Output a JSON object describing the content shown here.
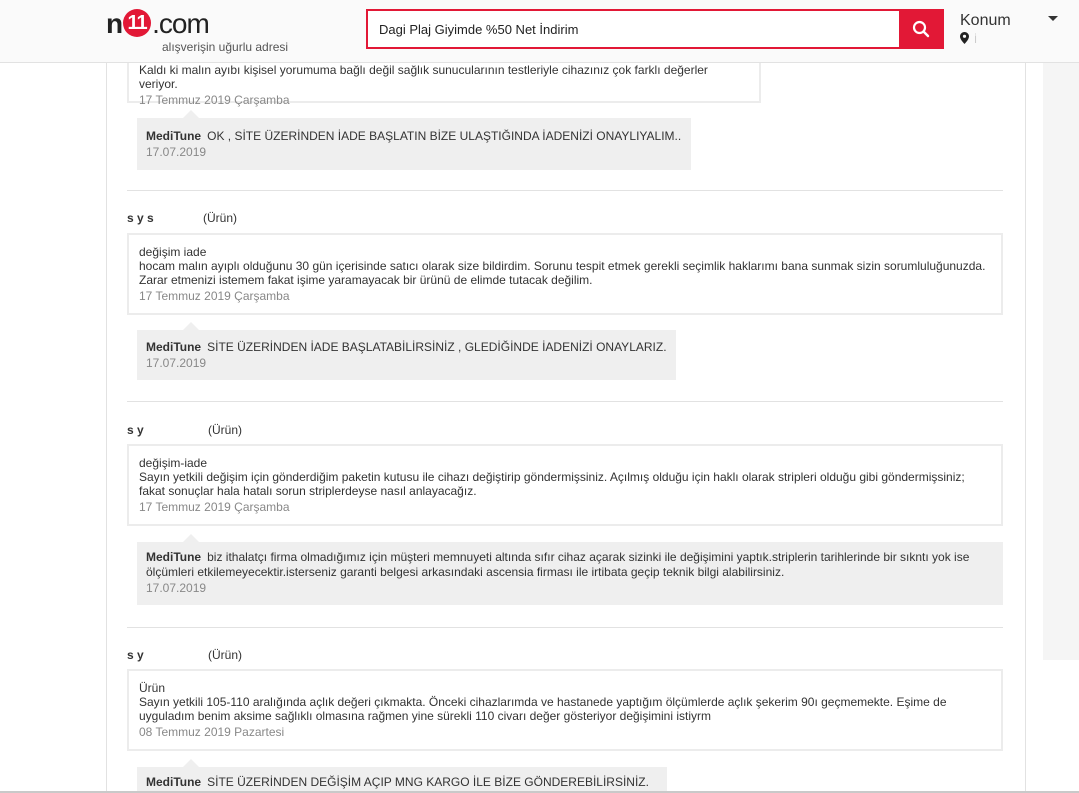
{
  "header": {
    "logo_n": "n",
    "logo_bug": "11",
    "logo_com": ".com",
    "logo_tagline": "alışverişin uğurlu adresi",
    "search_value": "Dagi Plaj Giyimde %50 Net İndirim",
    "konum_label": "Konum",
    "konum_value": "İ"
  },
  "thread1": {
    "question_text": "Kaldı ki malın ayıbı kişisel yorumuma bağlı değil sağlık sunucularının testleriyle cihazınız çok farklı değerler veriyor.",
    "question_date": "17 Temmuz 2019 Çarşamba",
    "answer_seller": "MediTune",
    "answer_text": "OK , SİTE ÜZERİNDEN İADE BAŞLATIN BİZE ULAŞTIĞINDA İADENİZİ ONAYLIYALIM..",
    "answer_date": "17.07.2019"
  },
  "thread2": {
    "user": "s y s",
    "tag": "(Ürün)",
    "question_title": "değişim iade",
    "question_text": "hocam malın ayıplı olduğunu 30 gün içerisinde satıcı olarak size bildirdim. Sorunu tespit etmek gerekli seçimlik haklarımı bana sunmak sizin sorumluluğunuzda. Zarar etmenizi istemem fakat işime yaramayacak bir ürünü de elimde tutacak değilim.",
    "question_date": "17 Temmuz 2019 Çarşamba",
    "answer_seller": "MediTune",
    "answer_text": "SİTE ÜZERİNDEN İADE BAŞLATABİLİRSİNİZ , GLEDİĞİNDE İADENİZİ ONAYLARIZ.",
    "answer_date": "17.07.2019"
  },
  "thread3": {
    "user": "s y",
    "tag": "(Ürün)",
    "question_title": "değişim-iade",
    "question_text": "Sayın yetkili değişim için gönderdiğim paketin kutusu ile cihazı değiştirip göndermişsiniz. Açılmış olduğu için haklı olarak stripleri olduğu gibi göndermişsiniz; fakat sonuçlar hala hatalı sorun striplerdeyse nasıl anlayacağız.",
    "question_date": "17 Temmuz 2019 Çarşamba",
    "answer_seller": "MediTune",
    "answer_text": "biz ithalatçı firma olmadığımız için müşteri memnuyeti altında sıfır cihaz açarak sizinki ile değişimini yaptık.striplerin tarihlerinde bir sıkntı yok ise ölçümleri etkilemeyecektir.isterseniz garanti belgesi arkasındaki ascensia firması ile irtibata geçip teknik bilgi alabilirsiniz.",
    "answer_date": "17.07.2019"
  },
  "thread4": {
    "user": "s y",
    "tag": "(Ürün)",
    "question_title": "Ürün",
    "question_text": "Sayın yetkili 105-110 aralığında açlık değeri çıkmakta. Önceki cihazlarımda ve hastanede yaptığım ölçümlerde açlık şekerim 90ı geçmemekte. Eşime de uyguladım benim aksime sağlıklı olmasına rağmen yine sürekli 110 civarı değer gösteriyor değişimini istiyrm",
    "question_date": "08 Temmuz 2019 Pazartesi",
    "answer_seller": "MediTune",
    "answer_text": "SİTE ÜZERİNDEN DEĞİŞİM AÇIP MNG KARGO İLE BİZE GÖNDEREBİLİRSİNİZ."
  },
  "colors": {
    "brand": "#e21836",
    "answer_bg": "#efefef",
    "date_text": "#888888"
  }
}
